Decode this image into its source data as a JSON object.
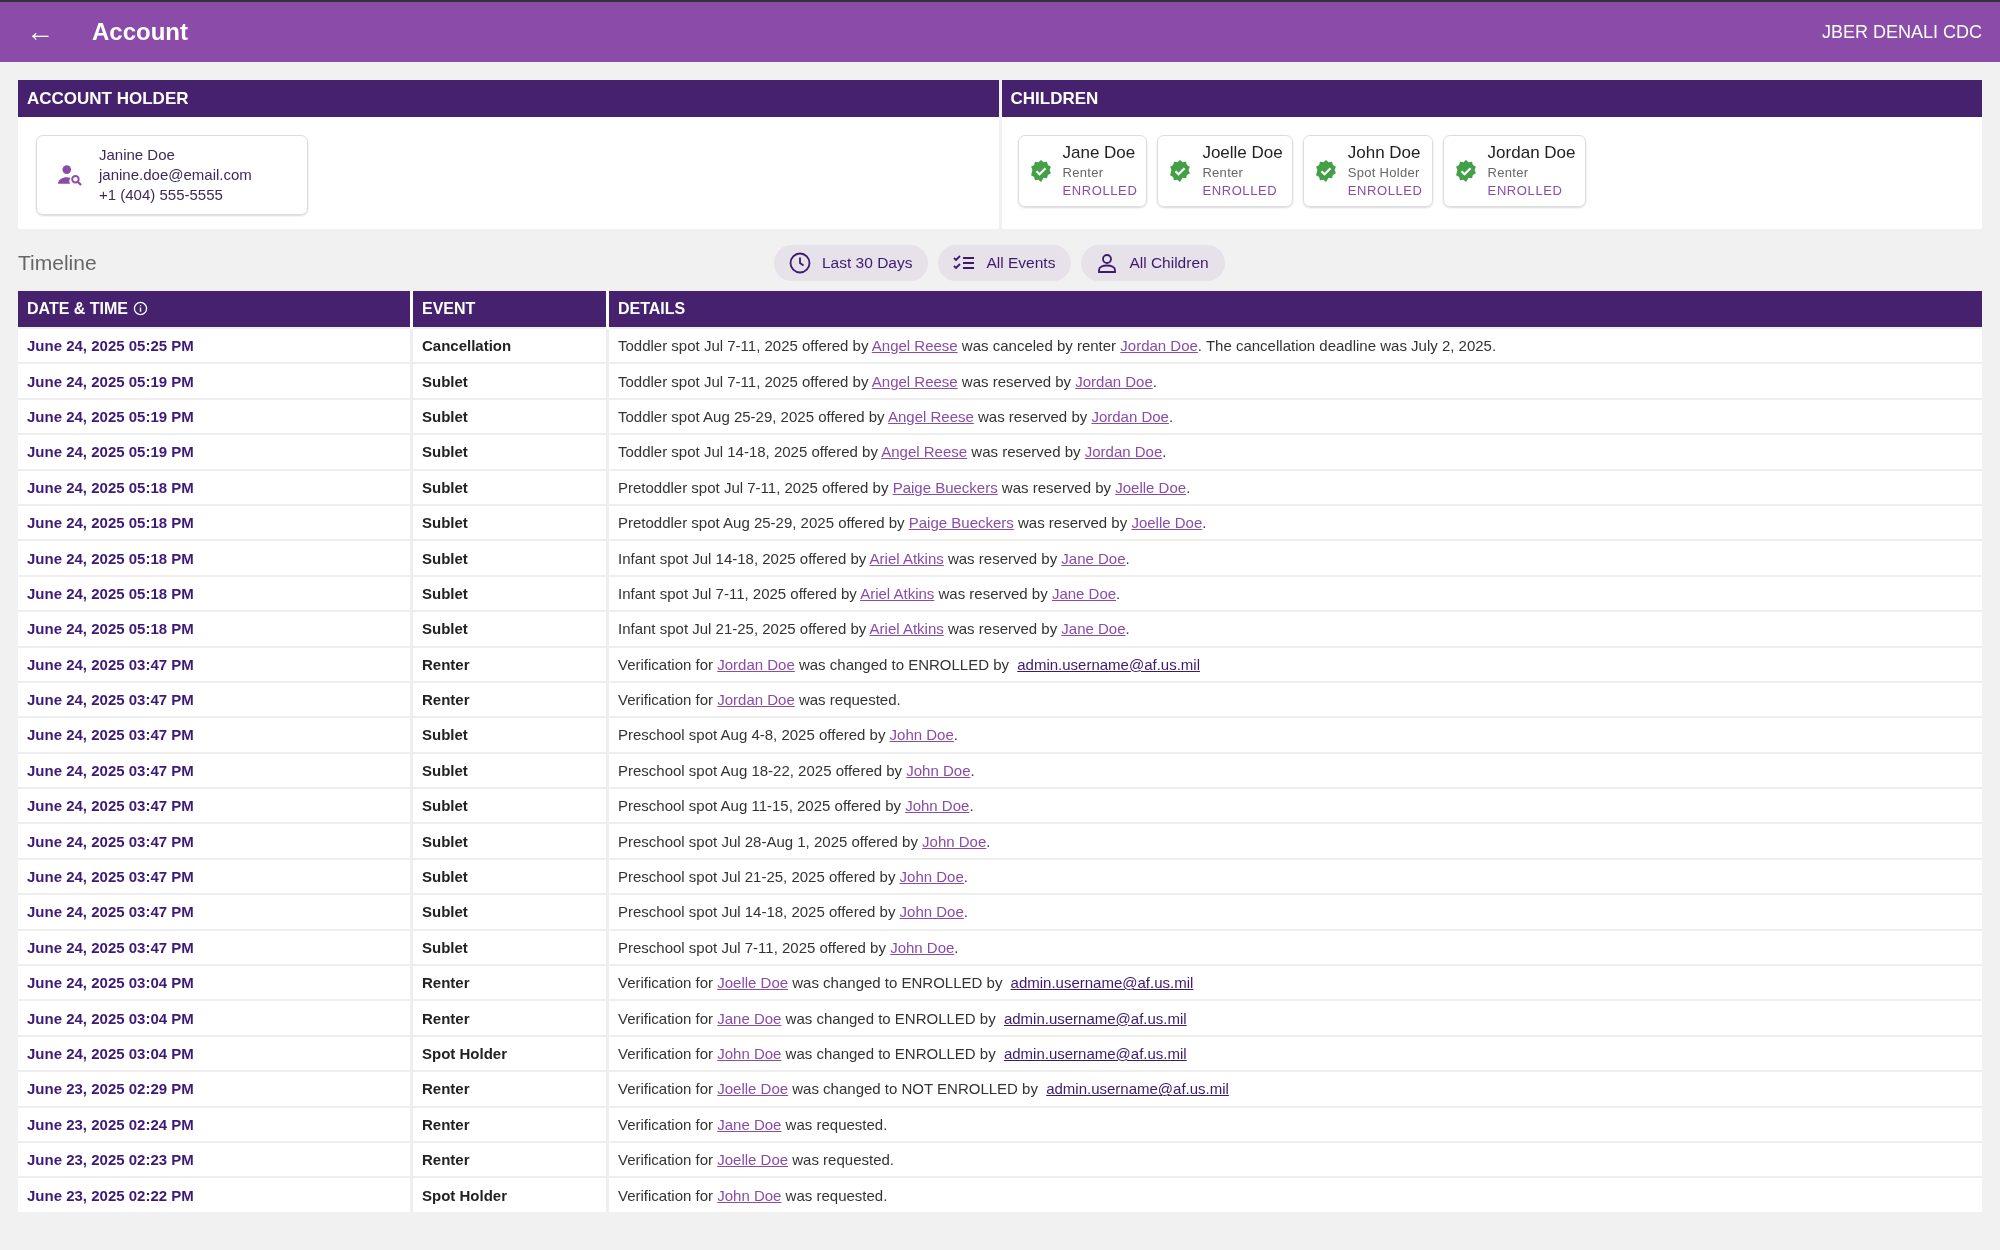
{
  "app_bar": {
    "back_icon": "←",
    "title": "Account",
    "site": "JBER DENALI CDC"
  },
  "account_holder": {
    "heading": "ACCOUNT HOLDER",
    "name": "Janine Doe",
    "email": "janine.doe@email.com",
    "phone": "+1 (404) 555-5555"
  },
  "children": {
    "heading": "CHILDREN",
    "items": [
      {
        "name": "Jane Doe",
        "role": "Renter",
        "status": "ENROLLED"
      },
      {
        "name": "Joelle Doe",
        "role": "Renter",
        "status": "ENROLLED"
      },
      {
        "name": "John Doe",
        "role": "Spot Holder",
        "status": "ENROLLED"
      },
      {
        "name": "Jordan Doe",
        "role": "Renter",
        "status": "ENROLLED"
      }
    ]
  },
  "timeline": {
    "title": "Timeline",
    "filters": [
      {
        "kind": "clock",
        "label": "Last 30 Days"
      },
      {
        "kind": "checklist",
        "label": "All Events"
      },
      {
        "kind": "person",
        "label": "All Children"
      }
    ],
    "columns": [
      "DATE & TIME",
      "EVENT",
      "DETAILS"
    ],
    "rows": [
      {
        "date": "June 24, 2025 05:25 PM",
        "event": "Cancellation",
        "details": [
          {
            "kind": "text",
            "text": "Toddler spot Jul 7-11, 2025 offered by "
          },
          {
            "kind": "link",
            "text": "Angel Reese"
          },
          {
            "kind": "text",
            "text": " was canceled by renter "
          },
          {
            "kind": "link",
            "text": "Jordan Doe"
          },
          {
            "kind": "text",
            "text": ". The cancellation deadline was July 2, 2025."
          }
        ]
      },
      {
        "date": "June 24, 2025 05:19 PM",
        "event": "Sublet",
        "details": [
          {
            "kind": "text",
            "text": "Toddler spot Jul 7-11, 2025 offered by "
          },
          {
            "kind": "link",
            "text": "Angel Reese"
          },
          {
            "kind": "text",
            "text": " was reserved by "
          },
          {
            "kind": "link",
            "text": "Jordan Doe"
          },
          {
            "kind": "text",
            "text": "."
          }
        ]
      },
      {
        "date": "June 24, 2025 05:19 PM",
        "event": "Sublet",
        "details": [
          {
            "kind": "text",
            "text": "Toddler spot Aug 25-29, 2025 offered by "
          },
          {
            "kind": "link",
            "text": "Angel Reese"
          },
          {
            "kind": "text",
            "text": " was reserved by "
          },
          {
            "kind": "link",
            "text": "Jordan Doe"
          },
          {
            "kind": "text",
            "text": "."
          }
        ]
      },
      {
        "date": "June 24, 2025 05:19 PM",
        "event": "Sublet",
        "details": [
          {
            "kind": "text",
            "text": "Toddler spot Jul 14-18, 2025 offered by "
          },
          {
            "kind": "link",
            "text": "Angel Reese"
          },
          {
            "kind": "text",
            "text": " was reserved by "
          },
          {
            "kind": "link",
            "text": "Jordan Doe"
          },
          {
            "kind": "text",
            "text": "."
          }
        ]
      },
      {
        "date": "June 24, 2025 05:18 PM",
        "event": "Sublet",
        "details": [
          {
            "kind": "text",
            "text": "Pretoddler spot Jul 7-11, 2025 offered by "
          },
          {
            "kind": "link",
            "text": "Paige Bueckers"
          },
          {
            "kind": "text",
            "text": " was reserved by "
          },
          {
            "kind": "link",
            "text": "Joelle Doe"
          },
          {
            "kind": "text",
            "text": "."
          }
        ]
      },
      {
        "date": "June 24, 2025 05:18 PM",
        "event": "Sublet",
        "details": [
          {
            "kind": "text",
            "text": "Pretoddler spot Aug 25-29, 2025 offered by "
          },
          {
            "kind": "link",
            "text": "Paige Bueckers"
          },
          {
            "kind": "text",
            "text": " was reserved by "
          },
          {
            "kind": "link",
            "text": "Joelle Doe"
          },
          {
            "kind": "text",
            "text": "."
          }
        ]
      },
      {
        "date": "June 24, 2025 05:18 PM",
        "event": "Sublet",
        "details": [
          {
            "kind": "text",
            "text": "Infant spot Jul 14-18, 2025 offered by "
          },
          {
            "kind": "link",
            "text": "Ariel Atkins"
          },
          {
            "kind": "text",
            "text": " was reserved by "
          },
          {
            "kind": "link",
            "text": "Jane Doe"
          },
          {
            "kind": "text",
            "text": "."
          }
        ]
      },
      {
        "date": "June 24, 2025 05:18 PM",
        "event": "Sublet",
        "details": [
          {
            "kind": "text",
            "text": "Infant spot Jul 7-11, 2025 offered by "
          },
          {
            "kind": "link",
            "text": "Ariel Atkins"
          },
          {
            "kind": "text",
            "text": " was reserved by "
          },
          {
            "kind": "link",
            "text": "Jane Doe"
          },
          {
            "kind": "text",
            "text": "."
          }
        ]
      },
      {
        "date": "June 24, 2025 05:18 PM",
        "event": "Sublet",
        "details": [
          {
            "kind": "text",
            "text": "Infant spot Jul 21-25, 2025 offered by "
          },
          {
            "kind": "link",
            "text": "Ariel Atkins"
          },
          {
            "kind": "text",
            "text": " was reserved by "
          },
          {
            "kind": "link",
            "text": "Jane Doe"
          },
          {
            "kind": "text",
            "text": "."
          }
        ]
      },
      {
        "date": "June 24, 2025 03:47 PM",
        "event": "Renter",
        "details": [
          {
            "kind": "text",
            "text": "Verification for "
          },
          {
            "kind": "link",
            "text": "Jordan Doe"
          },
          {
            "kind": "text",
            "text": " was changed to ENROLLED by "
          },
          {
            "kind": "email",
            "text": "admin.username@af.us.mil"
          }
        ]
      },
      {
        "date": "June 24, 2025 03:47 PM",
        "event": "Renter",
        "details": [
          {
            "kind": "text",
            "text": "Verification for "
          },
          {
            "kind": "link",
            "text": "Jordan Doe"
          },
          {
            "kind": "text",
            "text": " was requested."
          }
        ]
      },
      {
        "date": "June 24, 2025 03:47 PM",
        "event": "Sublet",
        "details": [
          {
            "kind": "text",
            "text": "Preschool spot Aug 4-8, 2025 offered by "
          },
          {
            "kind": "link",
            "text": "John Doe"
          },
          {
            "kind": "text",
            "text": "."
          }
        ]
      },
      {
        "date": "June 24, 2025 03:47 PM",
        "event": "Sublet",
        "details": [
          {
            "kind": "text",
            "text": "Preschool spot Aug 18-22, 2025 offered by "
          },
          {
            "kind": "link",
            "text": "John Doe"
          },
          {
            "kind": "text",
            "text": "."
          }
        ]
      },
      {
        "date": "June 24, 2025 03:47 PM",
        "event": "Sublet",
        "details": [
          {
            "kind": "text",
            "text": "Preschool spot Aug 11-15, 2025 offered by "
          },
          {
            "kind": "link",
            "text": "John Doe"
          },
          {
            "kind": "text",
            "text": "."
          }
        ]
      },
      {
        "date": "June 24, 2025 03:47 PM",
        "event": "Sublet",
        "details": [
          {
            "kind": "text",
            "text": "Preschool spot Jul 28-Aug 1, 2025 offered by "
          },
          {
            "kind": "link",
            "text": "John Doe"
          },
          {
            "kind": "text",
            "text": "."
          }
        ]
      },
      {
        "date": "June 24, 2025 03:47 PM",
        "event": "Sublet",
        "details": [
          {
            "kind": "text",
            "text": "Preschool spot Jul 21-25, 2025 offered by "
          },
          {
            "kind": "link",
            "text": "John Doe"
          },
          {
            "kind": "text",
            "text": "."
          }
        ]
      },
      {
        "date": "June 24, 2025 03:47 PM",
        "event": "Sublet",
        "details": [
          {
            "kind": "text",
            "text": "Preschool spot Jul 14-18, 2025 offered by "
          },
          {
            "kind": "link",
            "text": "John Doe"
          },
          {
            "kind": "text",
            "text": "."
          }
        ]
      },
      {
        "date": "June 24, 2025 03:47 PM",
        "event": "Sublet",
        "details": [
          {
            "kind": "text",
            "text": "Preschool spot Jul 7-11, 2025 offered by "
          },
          {
            "kind": "link",
            "text": "John Doe"
          },
          {
            "kind": "text",
            "text": "."
          }
        ]
      },
      {
        "date": "June 24, 2025 03:04 PM",
        "event": "Renter",
        "details": [
          {
            "kind": "text",
            "text": "Verification for "
          },
          {
            "kind": "link",
            "text": "Joelle Doe"
          },
          {
            "kind": "text",
            "text": " was changed to ENROLLED by "
          },
          {
            "kind": "email",
            "text": "admin.username@af.us.mil"
          }
        ]
      },
      {
        "date": "June 24, 2025 03:04 PM",
        "event": "Renter",
        "details": [
          {
            "kind": "text",
            "text": "Verification for "
          },
          {
            "kind": "link",
            "text": "Jane Doe"
          },
          {
            "kind": "text",
            "text": " was changed to ENROLLED by "
          },
          {
            "kind": "email",
            "text": "admin.username@af.us.mil"
          }
        ]
      },
      {
        "date": "June 24, 2025 03:04 PM",
        "event": "Spot Holder",
        "details": [
          {
            "kind": "text",
            "text": "Verification for "
          },
          {
            "kind": "link",
            "text": "John Doe"
          },
          {
            "kind": "text",
            "text": " was changed to ENROLLED by "
          },
          {
            "kind": "email",
            "text": "admin.username@af.us.mil"
          }
        ]
      },
      {
        "date": "June 23, 2025 02:29 PM",
        "event": "Renter",
        "details": [
          {
            "kind": "text",
            "text": "Verification for "
          },
          {
            "kind": "link",
            "text": "Joelle Doe"
          },
          {
            "kind": "text",
            "text": " was changed to NOT ENROLLED by "
          },
          {
            "kind": "email",
            "text": "admin.username@af.us.mil"
          }
        ]
      },
      {
        "date": "June 23, 2025 02:24 PM",
        "event": "Renter",
        "details": [
          {
            "kind": "text",
            "text": "Verification for "
          },
          {
            "kind": "link",
            "text": "Jane Doe"
          },
          {
            "kind": "text",
            "text": " was requested."
          }
        ]
      },
      {
        "date": "June 23, 2025 02:23 PM",
        "event": "Renter",
        "details": [
          {
            "kind": "text",
            "text": "Verification for "
          },
          {
            "kind": "link",
            "text": "Joelle Doe"
          },
          {
            "kind": "text",
            "text": " was requested."
          }
        ]
      },
      {
        "date": "June 23, 2025 02:22 PM",
        "event": "Spot Holder",
        "details": [
          {
            "kind": "text",
            "text": "Verification for "
          },
          {
            "kind": "link",
            "text": "John Doe"
          },
          {
            "kind": "text",
            "text": " was requested."
          }
        ]
      }
    ]
  }
}
